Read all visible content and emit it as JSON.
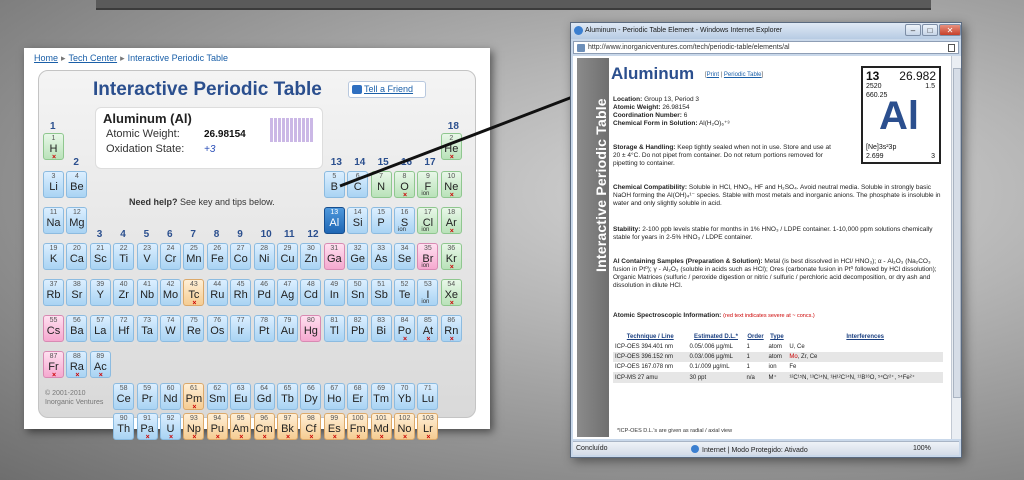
{
  "breadcrumb": {
    "home": "Home",
    "tech": "Tech Center",
    "current": "Interactive Periodic Table"
  },
  "table": {
    "title": "Interactive Periodic Table",
    "tell_friend": "Tell a Friend",
    "help_bold": "Need help?",
    "help_rest": " See key and tips below.",
    "copyright_1": "© 2001-2010",
    "copyright_2": "Inorganic Ventures",
    "info": {
      "name": "Aluminum (Al)",
      "weight_label": "Atomic Weight:",
      "weight": "26.98154",
      "ox_label": "Oxidation State:",
      "ox": "+3"
    },
    "groups": [
      "1",
      "2",
      "3",
      "4",
      "5",
      "6",
      "7",
      "8",
      "9",
      "10",
      "11",
      "12",
      "13",
      "14",
      "15",
      "16",
      "17",
      "18"
    ]
  },
  "elements": [
    {
      "n": "1",
      "s": "H",
      "c": "g",
      "x": true
    },
    {
      "n": "2",
      "s": "He",
      "c": "g",
      "x": true
    },
    {
      "n": "3",
      "s": "Li"
    },
    {
      "n": "4",
      "s": "Be"
    },
    {
      "n": "5",
      "s": "B"
    },
    {
      "n": "6",
      "s": "C"
    },
    {
      "n": "7",
      "s": "N",
      "c": "g"
    },
    {
      "n": "8",
      "s": "O",
      "c": "g",
      "x": true
    },
    {
      "n": "9",
      "s": "F",
      "c": "g",
      "io": "ion"
    },
    {
      "n": "10",
      "s": "Ne",
      "c": "g",
      "x": true
    },
    {
      "n": "11",
      "s": "Na"
    },
    {
      "n": "12",
      "s": "Mg"
    },
    {
      "n": "13",
      "s": "Al",
      "c": "sel"
    },
    {
      "n": "14",
      "s": "Si"
    },
    {
      "n": "15",
      "s": "P"
    },
    {
      "n": "16",
      "s": "S",
      "io": "ion"
    },
    {
      "n": "17",
      "s": "Cl",
      "c": "g",
      "io": "ion"
    },
    {
      "n": "18",
      "s": "Ar",
      "c": "g",
      "x": true
    },
    {
      "n": "19",
      "s": "K"
    },
    {
      "n": "20",
      "s": "Ca"
    },
    {
      "n": "21",
      "s": "Sc"
    },
    {
      "n": "22",
      "s": "Ti"
    },
    {
      "n": "23",
      "s": "V"
    },
    {
      "n": "24",
      "s": "Cr"
    },
    {
      "n": "25",
      "s": "Mn"
    },
    {
      "n": "26",
      "s": "Fe"
    },
    {
      "n": "27",
      "s": "Co"
    },
    {
      "n": "28",
      "s": "Ni"
    },
    {
      "n": "29",
      "s": "Cu"
    },
    {
      "n": "30",
      "s": "Zn"
    },
    {
      "n": "31",
      "s": "Ga",
      "c": "p"
    },
    {
      "n": "32",
      "s": "Ge"
    },
    {
      "n": "33",
      "s": "As"
    },
    {
      "n": "34",
      "s": "Se"
    },
    {
      "n": "35",
      "s": "Br",
      "c": "p",
      "io": "ion"
    },
    {
      "n": "36",
      "s": "Kr",
      "c": "g",
      "x": true
    },
    {
      "n": "37",
      "s": "Rb"
    },
    {
      "n": "38",
      "s": "Sr"
    },
    {
      "n": "39",
      "s": "Y"
    },
    {
      "n": "40",
      "s": "Zr"
    },
    {
      "n": "41",
      "s": "Nb"
    },
    {
      "n": "42",
      "s": "Mo"
    },
    {
      "n": "43",
      "s": "Tc",
      "c": "o",
      "x": true
    },
    {
      "n": "44",
      "s": "Ru"
    },
    {
      "n": "45",
      "s": "Rh"
    },
    {
      "n": "46",
      "s": "Pd"
    },
    {
      "n": "47",
      "s": "Ag"
    },
    {
      "n": "48",
      "s": "Cd"
    },
    {
      "n": "49",
      "s": "In"
    },
    {
      "n": "50",
      "s": "Sn"
    },
    {
      "n": "51",
      "s": "Sb"
    },
    {
      "n": "52",
      "s": "Te"
    },
    {
      "n": "53",
      "s": "I",
      "io": "ion"
    },
    {
      "n": "54",
      "s": "Xe",
      "c": "g",
      "x": true
    },
    {
      "n": "55",
      "s": "Cs",
      "c": "p"
    },
    {
      "n": "56",
      "s": "Ba"
    },
    {
      "n": "57",
      "s": "La"
    },
    {
      "n": "72",
      "s": "Hf"
    },
    {
      "n": "73",
      "s": "Ta"
    },
    {
      "n": "74",
      "s": "W"
    },
    {
      "n": "75",
      "s": "Re"
    },
    {
      "n": "76",
      "s": "Os"
    },
    {
      "n": "77",
      "s": "Ir"
    },
    {
      "n": "78",
      "s": "Pt"
    },
    {
      "n": "79",
      "s": "Au"
    },
    {
      "n": "80",
      "s": "Hg",
      "c": "p"
    },
    {
      "n": "81",
      "s": "Tl"
    },
    {
      "n": "82",
      "s": "Pb"
    },
    {
      "n": "83",
      "s": "Bi"
    },
    {
      "n": "84",
      "s": "Po",
      "x": true
    },
    {
      "n": "85",
      "s": "At",
      "x": true
    },
    {
      "n": "86",
      "s": "Rn",
      "x": true
    },
    {
      "n": "87",
      "s": "Fr",
      "c": "p",
      "x": true
    },
    {
      "n": "88",
      "s": "Ra",
      "x": true
    },
    {
      "n": "89",
      "s": "Ac",
      "x": true
    },
    {
      "n": "58",
      "s": "Ce"
    },
    {
      "n": "59",
      "s": "Pr"
    },
    {
      "n": "60",
      "s": "Nd"
    },
    {
      "n": "61",
      "s": "Pm",
      "c": "o",
      "x": true
    },
    {
      "n": "62",
      "s": "Sm"
    },
    {
      "n": "63",
      "s": "Eu"
    },
    {
      "n": "64",
      "s": "Gd"
    },
    {
      "n": "65",
      "s": "Tb"
    },
    {
      "n": "66",
      "s": "Dy"
    },
    {
      "n": "67",
      "s": "Ho"
    },
    {
      "n": "68",
      "s": "Er"
    },
    {
      "n": "69",
      "s": "Tm"
    },
    {
      "n": "70",
      "s": "Yb"
    },
    {
      "n": "71",
      "s": "Lu"
    },
    {
      "n": "90",
      "s": "Th"
    },
    {
      "n": "91",
      "s": "Pa",
      "x": true
    },
    {
      "n": "92",
      "s": "U",
      "x": true
    },
    {
      "n": "93",
      "s": "Np",
      "c": "o",
      "x": true
    },
    {
      "n": "94",
      "s": "Pu",
      "c": "o",
      "x": true
    },
    {
      "n": "95",
      "s": "Am",
      "c": "o",
      "x": true
    },
    {
      "n": "96",
      "s": "Cm",
      "c": "o",
      "x": true
    },
    {
      "n": "97",
      "s": "Bk",
      "c": "o",
      "x": true
    },
    {
      "n": "98",
      "s": "Cf",
      "c": "o",
      "x": true
    },
    {
      "n": "99",
      "s": "Es",
      "c": "o",
      "x": true
    },
    {
      "n": "100",
      "s": "Fm",
      "c": "o",
      "x": true
    },
    {
      "n": "101",
      "s": "Md",
      "c": "o",
      "x": true
    },
    {
      "n": "102",
      "s": "No",
      "c": "o",
      "x": true
    },
    {
      "n": "103",
      "s": "Lr",
      "c": "o",
      "x": true
    }
  ],
  "browser": {
    "title": "Aluminum - Periodic Table Element - Windows Internet Explorer",
    "url": "http://www.inorganicventures.com/tech/periodic-table/elements/al",
    "status_left": "Concluído",
    "status_mid": "Internet | Modo Protegido: Ativado",
    "zoom": "100%"
  },
  "page": {
    "side": "Interactive Periodic Table",
    "name": "Aluminum",
    "link_print": "Print",
    "link_pt": "Periodic Table",
    "tile": {
      "num": "13",
      "weight": "26.982",
      "l1": "2520",
      "r1": "1.5",
      "l2": "660.25",
      "sym": "Al",
      "ec": "[Ne]3s²3p",
      "dn": "2.699",
      "ox": "3"
    },
    "loc_lbl": "Location:",
    "loc": "Group 13, Period 3",
    "aw_lbl": "Atomic Weight:",
    "aw": "26.98154",
    "cn_lbl": "Coordination Number:",
    "cn": "6",
    "cf_lbl": "Chemical Form in Solution:",
    "cf": "Al(H₂O)₆⁺³",
    "sh_lbl": "Storage & Handling:",
    "sh": "Keep tightly sealed when not in use. Store and use at 20 ± 4°C. Do not pipet from container. Do not return portions removed for pipetting to container.",
    "cc_lbl": "Chemical Compatibility:",
    "cc": "Soluble in HCl, HNO₃, HF and H₂SO₄. Avoid neutral media. Soluble in strongly basic NaOH forming the Al(OH)₄¹⁻ species. Stable with most metals and inorganic anions. The phosphate is insoluble in water and only slightly soluble in acid.",
    "st_lbl": "Stability:",
    "st": "2-100 ppb levels stable for months in 1% HNO₃ / LDPE container. 1-10,000 ppm solutions chemically stable for years in 2-5% HNO₃ / LDPE container.",
    "ac_lbl": "Al Containing Samples (Preparation & Solution):",
    "ac": "Metal (is best dissolved in HCl/ HNO₃); α - Al₂O₃ (Na₂CO₃ fusion in Pt⁰); γ - Al₂O₃ (soluble in acids such as HCl); Ores (carbonate fusion in Pt⁰ followed by HCl dissolution); Organic Matrices (sulfuric / peroxide digestion or nitric / sulfuric / perchloric acid decomposition, or dry ash and dissolution in dilute HCl.",
    "asi_lbl": "Atomic Spectroscopic Information:",
    "asi_note": "(red text indicates severe at ~ concs.)",
    "cols": [
      "Technique / Line",
      "Estimated D.L.*",
      "Order",
      "Type",
      "Interferences"
    ],
    "rows": [
      [
        "ICP-OES 394.401 nm",
        "0.05/.006 µg/mL",
        "1",
        "atom",
        "U, Ce"
      ],
      [
        "ICP-OES 396.152 nm",
        "0.03/.006 µg/mL",
        "1",
        "atom",
        "Mo, Zr, Ce"
      ],
      [
        "ICP-OES 167.078 nm",
        "0.1/.009 µg/mL",
        "1",
        "ion",
        "Fe"
      ],
      [
        "ICP-MS 27 amu",
        "30 ppt",
        "n/a",
        "M⁺",
        "¹²C¹⁵N, ¹³C¹⁴N, ¹H¹²C¹⁴N, ¹¹B¹⁶O, ⁵⁴Cr²⁺, ⁵⁴Fe²⁺"
      ]
    ],
    "foot": "*ICP-OES D.L.'s are given as radial / axial view"
  }
}
